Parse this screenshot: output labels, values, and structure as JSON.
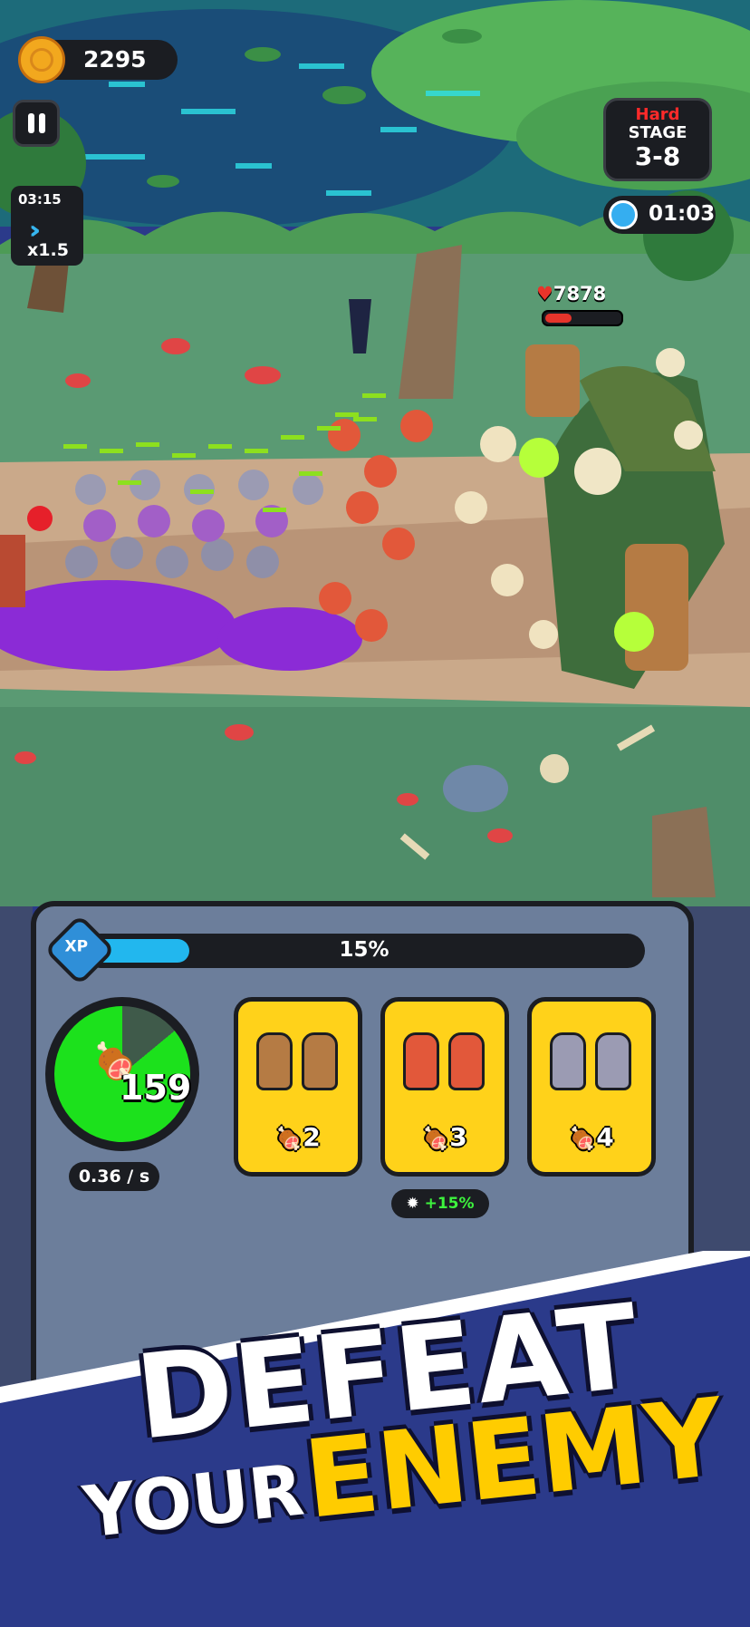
{
  "hud": {
    "coins": "2295",
    "speed_time": "03:15",
    "speed_multiplier": "x1.5",
    "difficulty": "Hard",
    "stage_label": "STAGE",
    "stage_number": "3-8",
    "timer": "01:03",
    "enemy_hp": "7878",
    "enemy_hp_fraction": 0.35
  },
  "panel": {
    "xp_label": "XP",
    "xp_percent_text": "15%",
    "xp_fraction": 0.15,
    "meat_count": "159",
    "meat_rate": "0.36 / s",
    "meat_fill_fraction": 0.86,
    "cards": [
      {
        "unit": "peasant",
        "cost": "2"
      },
      {
        "unit": "archer",
        "cost": "3"
      },
      {
        "unit": "knight",
        "cost": "4"
      }
    ],
    "bonus": "+15%"
  },
  "banner": {
    "line1": "DEFEAT",
    "line2a": "YOUR",
    "line2b": "ENEMY"
  },
  "colors": {
    "accent_yellow": "#ffd21a",
    "xp_blue": "#22b7ee",
    "meat_green": "#1ce11c",
    "hard_red": "#ff2a2a",
    "banner_navy": "#2b3a8a"
  },
  "icons": [
    "coin-icon",
    "pause-icon",
    "fast-forward-icon",
    "timer-icon",
    "heart-icon",
    "xp-badge-icon",
    "meat-icon",
    "rage-icon"
  ]
}
